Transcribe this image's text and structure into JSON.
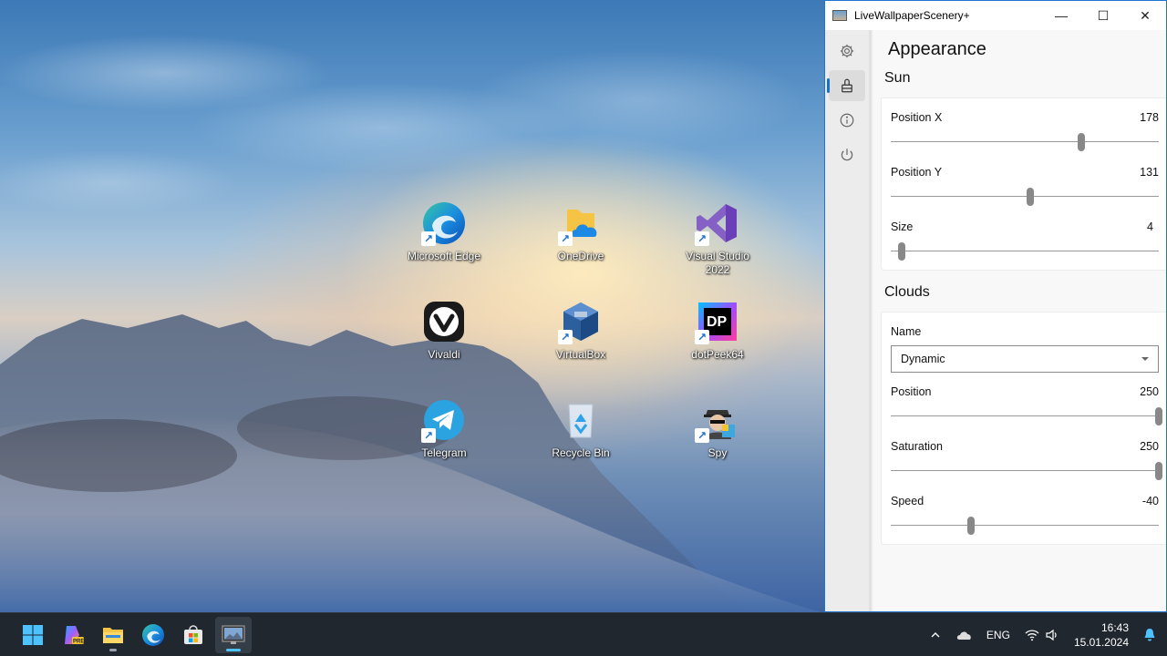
{
  "desktop": {
    "icons": [
      {
        "label": "Microsoft Edge",
        "icon": "edge-icon"
      },
      {
        "label": "OneDrive",
        "icon": "onedrive-icon"
      },
      {
        "label": "Visual Studio 2022",
        "icon": "visual-studio-icon"
      },
      {
        "label": "Vivaldi",
        "icon": "vivaldi-icon"
      },
      {
        "label": "VirtualBox",
        "icon": "virtualbox-icon"
      },
      {
        "label": "dotPeek64",
        "icon": "dotpeek-icon",
        "badge": "DP"
      },
      {
        "label": "Telegram",
        "icon": "telegram-icon"
      },
      {
        "label": "Recycle Bin",
        "icon": "recycle-bin-icon"
      },
      {
        "label": "Spy",
        "icon": "spy-icon"
      }
    ]
  },
  "window": {
    "title": "LiveWallpaperScenery+",
    "controls": {
      "minimize": "—",
      "maximize": "☐",
      "close": "✕"
    },
    "nav": [
      {
        "icon": "gear-icon"
      },
      {
        "icon": "paint-bucket-icon",
        "active": true
      },
      {
        "icon": "info-icon"
      },
      {
        "icon": "power-icon"
      }
    ],
    "page_title": "Appearance",
    "sun": {
      "title": "Sun",
      "position_x": {
        "label": "Position X",
        "value": "178",
        "level": 0.71
      },
      "position_y": {
        "label": "Position Y",
        "value": "131",
        "level": 0.52
      },
      "size": {
        "label": "Size",
        "value": "4",
        "level": 0.04
      }
    },
    "clouds": {
      "title": "Clouds",
      "name": {
        "label": "Name",
        "value": "Dynamic"
      },
      "position": {
        "label": "Position",
        "value": "250",
        "level": 1.0
      },
      "saturation": {
        "label": "Saturation",
        "value": "250",
        "level": 1.0
      },
      "speed": {
        "label": "Speed",
        "value": "-40",
        "level": 0.3
      }
    }
  },
  "taskbar": {
    "apps": [
      {
        "icon": "windows-start-icon"
      },
      {
        "icon": "copilot-pre-icon",
        "badge": "PRE"
      },
      {
        "icon": "file-explorer-icon"
      },
      {
        "icon": "edge-icon"
      },
      {
        "icon": "store-icon"
      },
      {
        "icon": "livewallpaper-icon",
        "active": true
      }
    ],
    "tray": {
      "language": "ENG",
      "time": "16:43",
      "date": "15.01.2024"
    }
  },
  "colors": {
    "accent": "#1a6fc9",
    "taskbar": "#20272f",
    "window_border": "#1f74cf"
  }
}
